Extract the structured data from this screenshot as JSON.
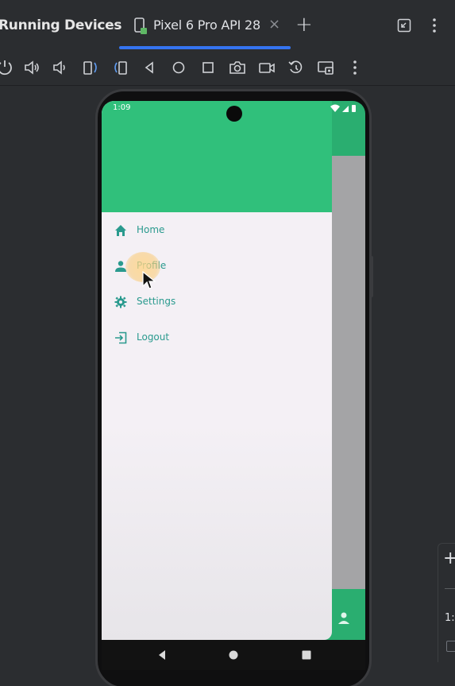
{
  "panel": {
    "title": "Running Devices"
  },
  "tab": {
    "label": "Pixel 6 Pro API 28",
    "close_glyph": "×"
  },
  "add_tab_glyph": "+",
  "toolbar_icons": [
    "power-icon",
    "volume-up-icon",
    "volume-down-icon",
    "rotate-left-icon",
    "rotate-right-icon",
    "back-icon",
    "home-icon",
    "overview-icon",
    "camera-icon",
    "screen-record-icon",
    "snapshot-icon",
    "extended-controls-icon",
    "more-icon"
  ],
  "device": {
    "status_time": "1:09",
    "drawer_items": [
      {
        "label": "Home",
        "icon": "home-icon"
      },
      {
        "label": "Profile",
        "icon": "person-icon"
      },
      {
        "label": "Settings",
        "icon": "gear-icon"
      },
      {
        "label": "Logout",
        "icon": "logout-icon"
      }
    ],
    "colors": {
      "accent_green": "#30c07b",
      "drawer_bg": "#f4f0f5",
      "menu_text": "#2a9a8e"
    }
  },
  "right_panel": {
    "plus_glyph": "+",
    "text": "1:"
  },
  "colors": {
    "ide_bg": "#2b2d30",
    "tab_underline": "#3574f0"
  }
}
